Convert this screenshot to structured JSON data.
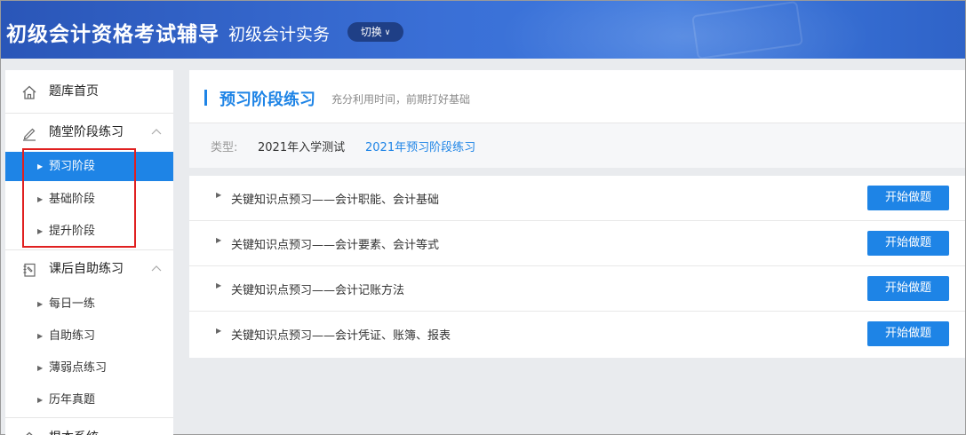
{
  "header": {
    "title": "初级会计资格考试辅导",
    "subject": "初级会计实务",
    "switch_label": "切换"
  },
  "sidebar": {
    "home": {
      "label": "题库首页",
      "icon": "home-icon"
    },
    "stage_practice": {
      "label": "随堂阶段练习",
      "icon": "pencil-icon",
      "items": [
        {
          "label": "预习阶段",
          "active": true
        },
        {
          "label": "基础阶段",
          "active": false
        },
        {
          "label": "提升阶段",
          "active": false
        }
      ]
    },
    "self_practice": {
      "label": "课后自助练习",
      "icon": "notebook-icon",
      "items": [
        {
          "label": "每日一练"
        },
        {
          "label": "自助练习"
        },
        {
          "label": "薄弱点练习"
        },
        {
          "label": "历年真题"
        }
      ]
    },
    "next_section_partial": "根本系统"
  },
  "main": {
    "title": "预习阶段练习",
    "description": "充分利用时间，前期打好基础",
    "filter": {
      "label": "类型:",
      "options": [
        {
          "label": "2021年入学测试",
          "active": false
        },
        {
          "label": "2021年预习阶段练习",
          "active": true
        }
      ]
    },
    "rows": [
      {
        "text": "关键知识点预习——会计职能、会计基础",
        "button": "开始做题"
      },
      {
        "text": "关键知识点预习——会计要素、会计等式",
        "button": "开始做题"
      },
      {
        "text": "关键知识点预习——会计记账方法",
        "button": "开始做题"
      },
      {
        "text": "关键知识点预习——会计凭证、账簿、报表",
        "button": "开始做题"
      }
    ]
  },
  "colors": {
    "accent": "#1e84e6",
    "header_bg": "#2f63c8",
    "highlight": "#e02020"
  }
}
